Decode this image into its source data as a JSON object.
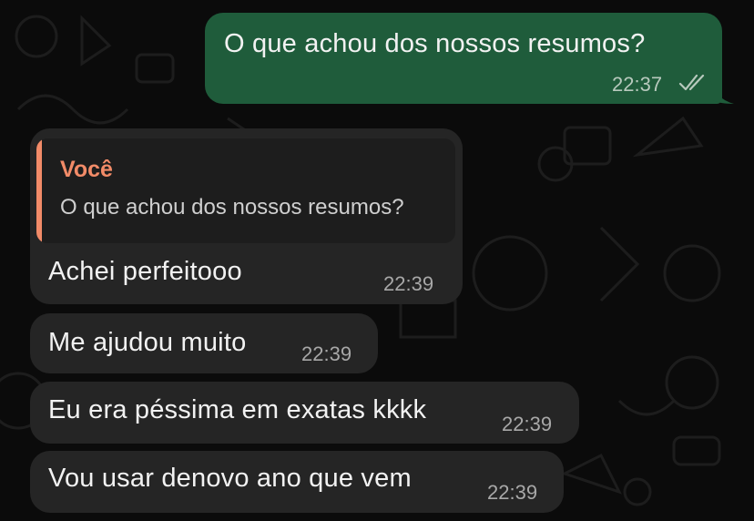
{
  "theme": {
    "outgoing_bubble_color": "#1f5c3b",
    "incoming_bubble_color": "#252525",
    "quote_accent_color": "#f28b68",
    "background_color": "#0b0b0b"
  },
  "outgoing_message": {
    "text": "O que achou dos nossos resumos?",
    "time": "22:37",
    "status_icon": "double-check-read-icon"
  },
  "reply": {
    "quote_author": "Você",
    "quote_text": "O que achou dos nossos resumos?",
    "text": "Achei perfeitooo",
    "time": "22:39"
  },
  "incoming_messages": [
    {
      "text": "Me ajudou muito",
      "time": "22:39"
    },
    {
      "text": "Eu era péssima em exatas kkkk",
      "time": "22:39"
    },
    {
      "text": "Vou usar denovo ano que vem",
      "time": "22:39"
    }
  ]
}
